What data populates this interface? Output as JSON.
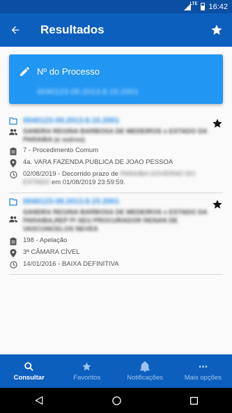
{
  "status_bar": {
    "time": "16:42",
    "network": "LTE"
  },
  "app_bar": {
    "title": "Resultados"
  },
  "process_card": {
    "label": "Nº do Processo",
    "number": "0040123-09.2013.8.15.2001"
  },
  "results": [
    {
      "number": "0040123-09.2013.8.15.2001",
      "parties": "SANDRA REGINA BARBOSA DE MEDEIROS x ESTADO DA PARAIBA (e outros)",
      "class": "7 - Procedimento Comum",
      "court": "4a. VARA FAZENDA PUBLICA DE JOAO PESSOA",
      "movement_date_prefix": "02/08/2019 - Decorrido prazo de",
      "movement_party": "PARAIBA GOVERNO DO ESTADO",
      "movement_date_suffix": "em 01/08/2019 23:59:59."
    },
    {
      "number": "0040123-09.2013.8.15.2001",
      "parties": "SANDRA REGINA BARBOSA DE MEDEIROS x ESTADO DA PARAIBA,REP P/ SEU PROCURADOR RENAN DE VASCONCELOS NEVES",
      "class": "198 - Apelação",
      "court": "3ª CÂMARA CÍVEL",
      "movement": "14/01/2016 - BAIXA DEFINITIVA"
    }
  ],
  "bottom_nav": [
    {
      "label": "Consultar",
      "icon": "search-icon",
      "active": true
    },
    {
      "label": "Favoritos",
      "icon": "star-icon",
      "active": false
    },
    {
      "label": "Notificações",
      "icon": "bell-icon",
      "active": false
    },
    {
      "label": "Mais opções",
      "icon": "more-dots-icon",
      "active": false
    }
  ],
  "colors": {
    "primary": "#0d5fbd",
    "status_bar": "#0a4fa3",
    "card": "#2196f3",
    "link": "#1e88e5"
  }
}
